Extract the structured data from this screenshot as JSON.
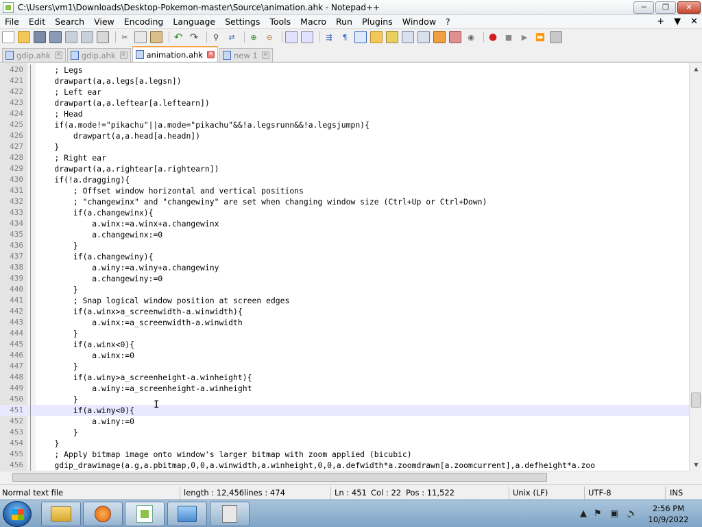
{
  "window": {
    "title": "C:\\Users\\vm1\\Downloads\\Desktop-Pokemon-master\\Source\\animation.ahk - Notepad++",
    "minimize_glyph": "─",
    "maximize_glyph": "❐",
    "close_glyph": "✕"
  },
  "menu": {
    "items": [
      "File",
      "Edit",
      "Search",
      "View",
      "Encoding",
      "Language",
      "Settings",
      "Tools",
      "Macro",
      "Run",
      "Plugins",
      "Window",
      "?"
    ],
    "right_plus": "+",
    "right_arrow": "▼",
    "right_x": "✕"
  },
  "tabs": [
    {
      "label": "gdip.ahk",
      "active": false
    },
    {
      "label": "gdip.ahk",
      "active": false
    },
    {
      "label": "animation.ahk",
      "active": true
    },
    {
      "label": "new 1",
      "active": false
    }
  ],
  "editor": {
    "current_line": "451",
    "lines": [
      {
        "n": "420",
        "code": "    ; Legs"
      },
      {
        "n": "421",
        "code": "    drawpart(a,a.legs[a.legsn])"
      },
      {
        "n": "422",
        "code": "    ; Left ear"
      },
      {
        "n": "423",
        "code": "    drawpart(a,a.leftear[a.leftearn])"
      },
      {
        "n": "424",
        "code": "    ; Head"
      },
      {
        "n": "425",
        "code": "    if(a.mode!=\"pikachu\"||a.mode=\"pikachu\"&&!a.legsrunn&&!a.legsjumpn){"
      },
      {
        "n": "426",
        "code": "        drawpart(a,a.head[a.headn])"
      },
      {
        "n": "427",
        "code": "    }"
      },
      {
        "n": "428",
        "code": "    ; Right ear"
      },
      {
        "n": "429",
        "code": "    drawpart(a,a.rightear[a.rightearn])"
      },
      {
        "n": "430",
        "code": "    if(!a.dragging){"
      },
      {
        "n": "431",
        "code": "        ; Offset window horizontal and vertical positions"
      },
      {
        "n": "432",
        "code": "        ; \"changewinx\" and \"changewiny\" are set when changing window size (Ctrl+Up or Ctrl+Down)"
      },
      {
        "n": "433",
        "code": "        if(a.changewinx){"
      },
      {
        "n": "434",
        "code": "            a.winx:=a.winx+a.changewinx"
      },
      {
        "n": "435",
        "code": "            a.changewinx:=0"
      },
      {
        "n": "436",
        "code": "        }"
      },
      {
        "n": "437",
        "code": "        if(a.changewiny){"
      },
      {
        "n": "438",
        "code": "            a.winy:=a.winy+a.changewiny"
      },
      {
        "n": "439",
        "code": "            a.changewiny:=0"
      },
      {
        "n": "440",
        "code": "        }"
      },
      {
        "n": "441",
        "code": "        ; Snap logical window position at screen edges"
      },
      {
        "n": "442",
        "code": "        if(a.winx>a_screenwidth-a.winwidth){"
      },
      {
        "n": "443",
        "code": "            a.winx:=a_screenwidth-a.winwidth"
      },
      {
        "n": "444",
        "code": "        }"
      },
      {
        "n": "445",
        "code": "        if(a.winx<0){"
      },
      {
        "n": "446",
        "code": "            a.winx:=0"
      },
      {
        "n": "447",
        "code": "        }"
      },
      {
        "n": "448",
        "code": "        if(a.winy>a_screenheight-a.winheight){"
      },
      {
        "n": "449",
        "code": "            a.winy:=a_screenheight-a.winheight"
      },
      {
        "n": "450",
        "code": "        }"
      },
      {
        "n": "451",
        "code": "        if(a.winy<0){"
      },
      {
        "n": "452",
        "code": "            a.winy:=0"
      },
      {
        "n": "453",
        "code": "        }"
      },
      {
        "n": "454",
        "code": "    }"
      },
      {
        "n": "455",
        "code": "    ; Apply bitmap image onto window's larger bitmap with zoom applied (bicubic)"
      },
      {
        "n": "456",
        "code": "    gdip_drawimage(a.g,a.pbitmap,0,0,a.winwidth,a.winheight,0,0,a.defwidth*a.zoomdrawn[a.zoomcurrent],a.defheight*a.zoo"
      }
    ]
  },
  "status": {
    "file_type": "Normal text file",
    "length": "length : 12,456",
    "lines": "lines : 474",
    "ln": "Ln : 451",
    "col": "Col : 22",
    "pos": "Pos : 11,522",
    "eol": "Unix (LF)",
    "encoding": "UTF-8",
    "mode": "INS"
  },
  "taskbar": {
    "time": "2:56 PM",
    "date": "10/9/2022"
  },
  "colors": {
    "comment": "#000000",
    "current_line_bg": "#e8e8ff",
    "active_tab_accent": "#f4a340"
  }
}
